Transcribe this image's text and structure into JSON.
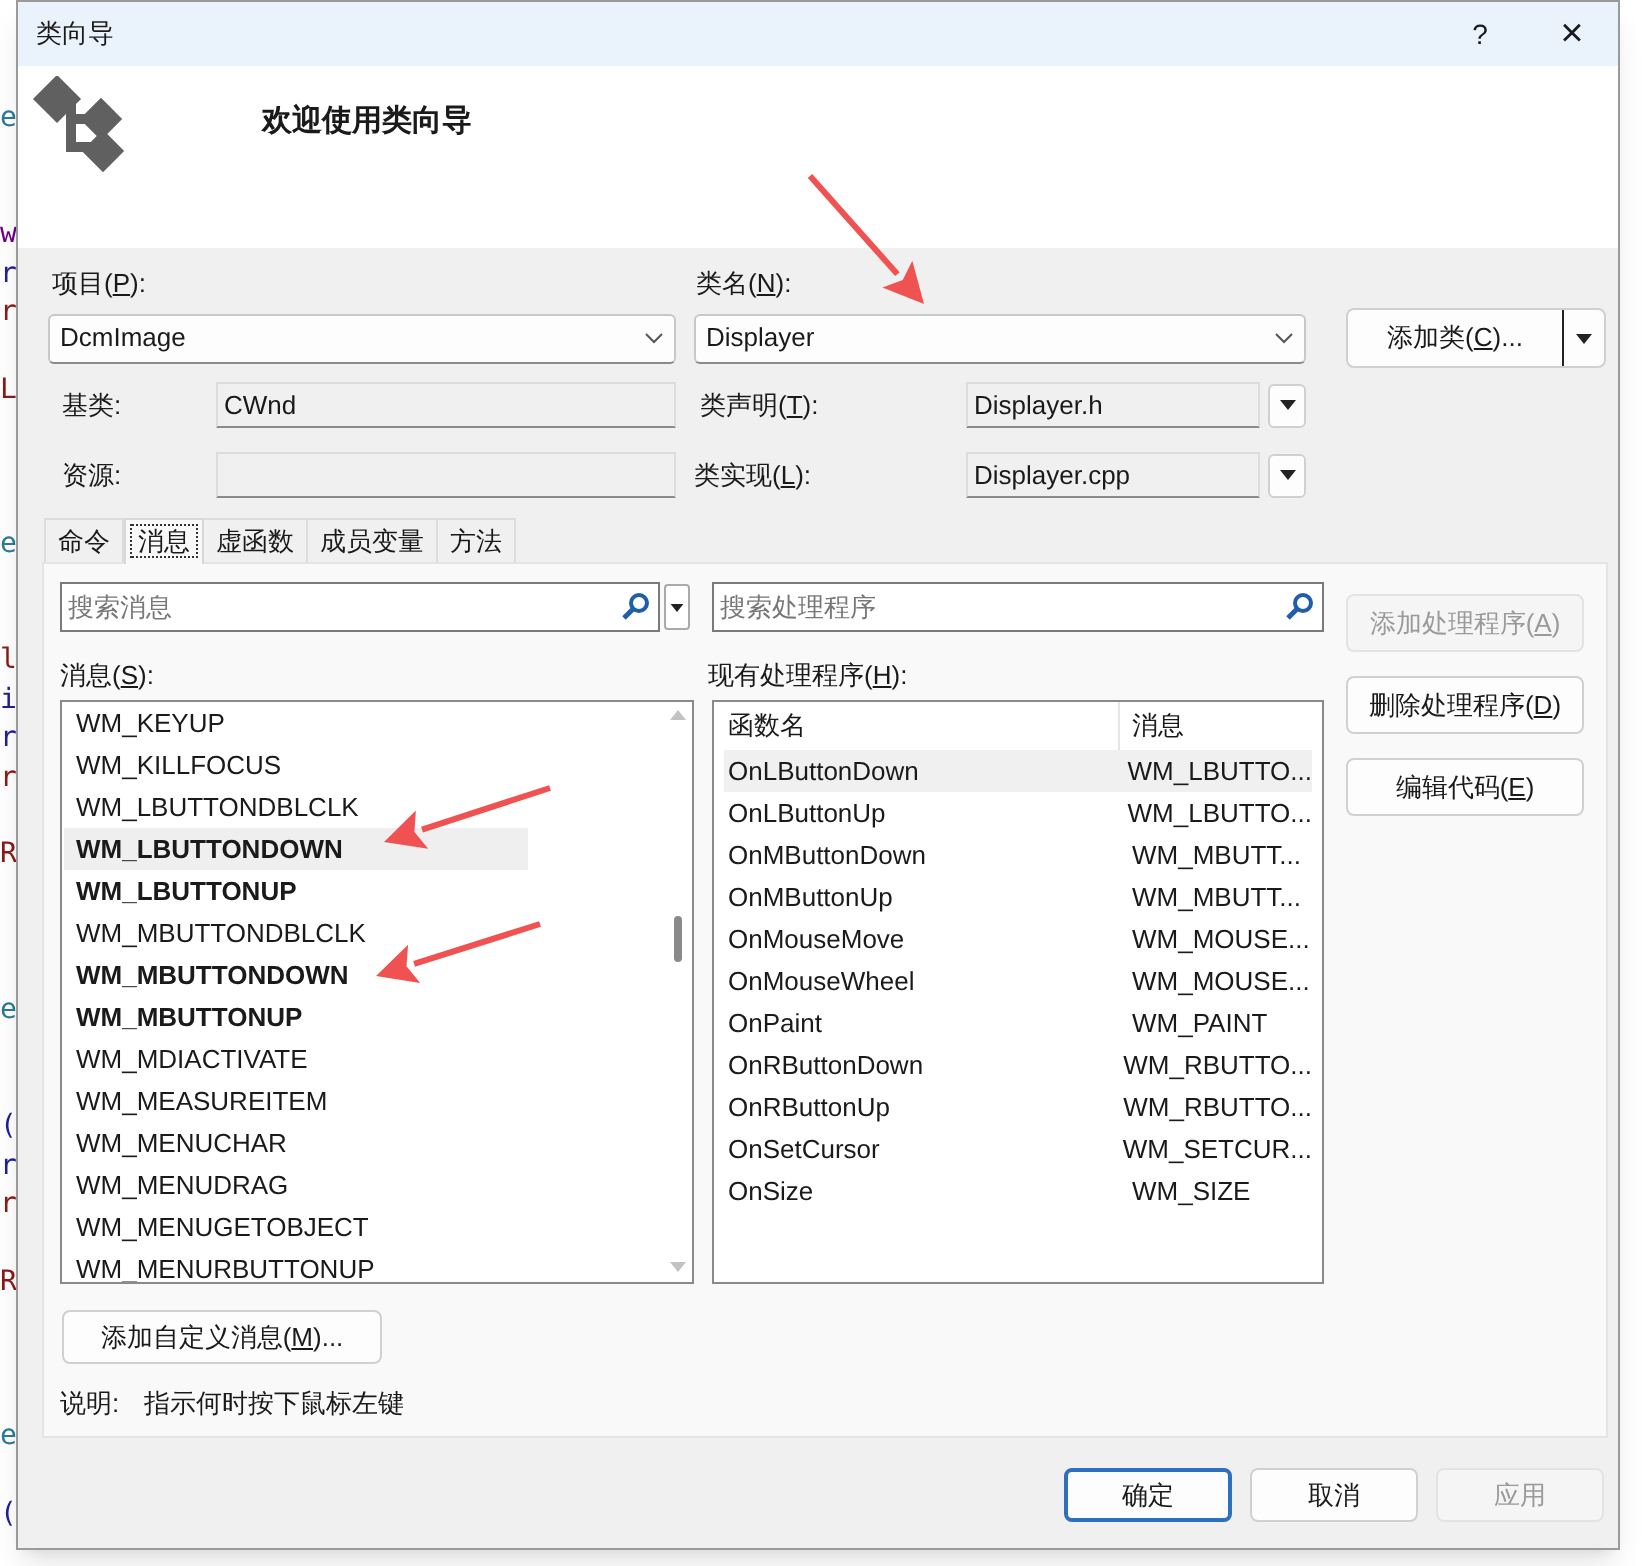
{
  "background_editor": {
    "lines": [
      {
        "kind": "code",
        "text": "e",
        "color": "#2b7a99"
      },
      {
        "kind": "blank"
      },
      {
        "kind": "blank"
      },
      {
        "kind": "code",
        "text": "w",
        "color": "#6f008a"
      },
      {
        "kind": "code",
        "text": "r",
        "color": "#1f1f9b"
      },
      {
        "kind": "code",
        "text": "r",
        "color": "#8b1a1a"
      },
      {
        "kind": "blank"
      },
      {
        "kind": "code",
        "text": "L",
        "color": "#8b1a1a"
      },
      {
        "kind": "blank"
      },
      {
        "kind": "blank"
      },
      {
        "kind": "blank"
      },
      {
        "kind": "code",
        "text": "e",
        "color": "#2b7a99"
      },
      {
        "kind": "blank"
      },
      {
        "kind": "blank"
      },
      {
        "kind": "code",
        "text": "l",
        "color": "#8b1a1a"
      },
      {
        "kind": "code",
        "text": "i",
        "color": "#1f1f9b"
      },
      {
        "kind": "code",
        "text": "r",
        "color": "#1f1f9b"
      },
      {
        "kind": "code",
        "text": "r",
        "color": "#8b1a1a"
      },
      {
        "kind": "blank"
      },
      {
        "kind": "code",
        "text": "R",
        "color": "#8b1a1a"
      },
      {
        "kind": "blank"
      },
      {
        "kind": "blank"
      },
      {
        "kind": "blank"
      },
      {
        "kind": "code",
        "text": "e",
        "color": "#2b7a99"
      },
      {
        "kind": "blank"
      },
      {
        "kind": "blank"
      },
      {
        "kind": "code",
        "text": "(",
        "color": "#1f1f9b"
      },
      {
        "kind": "code",
        "text": "r",
        "color": "#1f1f9b"
      },
      {
        "kind": "code",
        "text": "r",
        "color": "#8b1a1a"
      },
      {
        "kind": "blank"
      },
      {
        "kind": "code",
        "text": "R",
        "color": "#8b1a1a"
      },
      {
        "kind": "blank"
      },
      {
        "kind": "blank"
      },
      {
        "kind": "blank"
      },
      {
        "kind": "code",
        "text": "e",
        "color": "#2b7a99"
      },
      {
        "kind": "blank"
      },
      {
        "kind": "code",
        "text": "(",
        "color": "#1f1f9b"
      }
    ]
  },
  "window": {
    "title": "类向导",
    "help": "?",
    "close": "×"
  },
  "header": {
    "title": "欢迎使用类向导"
  },
  "project": {
    "label": "项目(P):",
    "value": "DcmImage"
  },
  "class_name": {
    "label": "类名(N):",
    "value": "Displayer"
  },
  "add_class_button": {
    "label": "添加类(C)..."
  },
  "base_class": {
    "label": "基类:",
    "value": "CWnd"
  },
  "class_declaration": {
    "label": "类声明(T):",
    "value": "Displayer.h"
  },
  "resource": {
    "label": "资源:"
  },
  "class_implementation": {
    "label": "类实现(L):",
    "value": "Displayer.cpp"
  },
  "tabs": [
    {
      "label": "命令",
      "selected": false
    },
    {
      "label": "消息",
      "selected": true
    },
    {
      "label": "虚函数",
      "selected": false
    },
    {
      "label": "成员变量",
      "selected": false
    },
    {
      "label": "方法",
      "selected": false
    }
  ],
  "message_search": {
    "placeholder": "搜索消息"
  },
  "handler_search": {
    "placeholder": "搜索处理程序"
  },
  "messages": {
    "label": "消息(S):",
    "items": [
      {
        "text": "WM_KEYUP",
        "has_handler": false,
        "selected": false
      },
      {
        "text": "WM_KILLFOCUS",
        "has_handler": false,
        "selected": false
      },
      {
        "text": "WM_LBUTTONDBLCLK",
        "has_handler": false,
        "selected": false
      },
      {
        "text": "WM_LBUTTONDOWN",
        "has_handler": true,
        "selected": true
      },
      {
        "text": "WM_LBUTTONUP",
        "has_handler": true,
        "selected": false
      },
      {
        "text": "WM_MBUTTONDBLCLK",
        "has_handler": false,
        "selected": false
      },
      {
        "text": "WM_MBUTTONDOWN",
        "has_handler": true,
        "selected": false
      },
      {
        "text": "WM_MBUTTONUP",
        "has_handler": true,
        "selected": false
      },
      {
        "text": "WM_MDIACTIVATE",
        "has_handler": false,
        "selected": false
      },
      {
        "text": "WM_MEASUREITEM",
        "has_handler": false,
        "selected": false
      },
      {
        "text": "WM_MENUCHAR",
        "has_handler": false,
        "selected": false
      },
      {
        "text": "WM_MENUDRAG",
        "has_handler": false,
        "selected": false
      },
      {
        "text": "WM_MENUGETOBJECT",
        "has_handler": false,
        "selected": false
      },
      {
        "text": "WM_MENURBUTTONUP",
        "has_handler": false,
        "selected": false
      }
    ]
  },
  "handlers": {
    "label": "现有处理程序(H):",
    "columns": [
      "函数名",
      "消息"
    ],
    "rows": [
      {
        "cells": [
          "OnLButtonDown",
          "WM_LBUTTO..."
        ],
        "selected": true
      },
      {
        "cells": [
          "OnLButtonUp",
          "WM_LBUTTO..."
        ],
        "selected": false
      },
      {
        "cells": [
          "OnMButtonDown",
          "WM_MBUTT..."
        ],
        "selected": false
      },
      {
        "cells": [
          "OnMButtonUp",
          "WM_MBUTT..."
        ],
        "selected": false
      },
      {
        "cells": [
          "OnMouseMove",
          "WM_MOUSE..."
        ],
        "selected": false
      },
      {
        "cells": [
          "OnMouseWheel",
          "WM_MOUSE..."
        ],
        "selected": false
      },
      {
        "cells": [
          "OnPaint",
          "WM_PAINT"
        ],
        "selected": false
      },
      {
        "cells": [
          "OnRButtonDown",
          "WM_RBUTTO..."
        ],
        "selected": false
      },
      {
        "cells": [
          "OnRButtonUp",
          "WM_RBUTTO..."
        ],
        "selected": false
      },
      {
        "cells": [
          "OnSetCursor",
          "WM_SETCUR..."
        ],
        "selected": false
      },
      {
        "cells": [
          "OnSize",
          "WM_SIZE"
        ],
        "selected": false
      }
    ]
  },
  "side_buttons": [
    {
      "label": "添加处理程序(A)",
      "disabled": true
    },
    {
      "label": "删除处理程序(D)",
      "disabled": false
    },
    {
      "label": "编辑代码(E)",
      "disabled": false
    }
  ],
  "add_custom_message_button": {
    "label": "添加自定义消息(M)..."
  },
  "description": {
    "label": "说明:",
    "text": "指示何时按下鼠标左键"
  },
  "footer_buttons": [
    {
      "label": "确定",
      "default": true,
      "disabled": false
    },
    {
      "label": "取消",
      "default": false,
      "disabled": false
    },
    {
      "label": "应用",
      "default": false,
      "disabled": true
    }
  ],
  "annotations": [
    {
      "kind": "arrow"
    },
    {
      "kind": "arrow"
    },
    {
      "kind": "arrow"
    }
  ]
}
